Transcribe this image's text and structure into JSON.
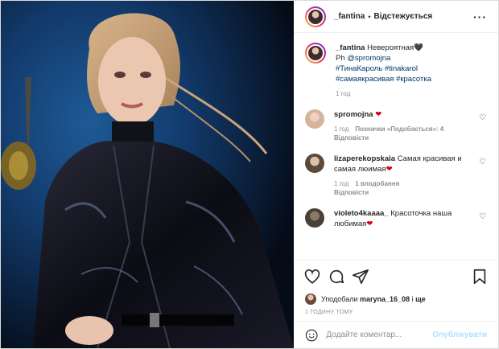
{
  "header": {
    "username": "_fantina",
    "separator": "•",
    "follow_label": "Відстежується",
    "more_icon": "more-horizontal-icon"
  },
  "caption": {
    "username": "_fantina",
    "text": "Невероятная",
    "heart": "🖤",
    "credit_prefix": "Ph ",
    "credit_mention": "@spromojna",
    "hashtags_line1": "#ТинаКароль #tinakarol",
    "hashtags_line2": "#самаякрасивая #красотка",
    "time": "1 год"
  },
  "comments": [
    {
      "username": "spromojna",
      "text": "",
      "heart": "❤",
      "time": "1 год",
      "likes": "Позначки «Подобається»: 4",
      "reply": "Відповісти"
    },
    {
      "username": "lizaperekopskaia",
      "text": "Самая красивая и самая люимая",
      "heart": "❤",
      "time": "1 год",
      "likes": "1 вподобання",
      "reply": "Відповісти"
    },
    {
      "username": "violeto4kaaaa_",
      "text": "Красоточка наша любимая",
      "heart": "❤",
      "time": "",
      "likes": "",
      "reply": ""
    }
  ],
  "likes_line": {
    "prefix": "Уподобали",
    "user": "maryna_16_08",
    "middle": "і",
    "suffix": "ще"
  },
  "post_time": "1 ГОДИНУ ТОМУ",
  "add_comment": {
    "placeholder": "Додайте коментар...",
    "post_label": "Опублікувати"
  },
  "colors": {
    "link": "#00376b",
    "muted": "#8e8e8e",
    "post_disabled": "#b2dffc",
    "heart_red": "#d0021b"
  }
}
